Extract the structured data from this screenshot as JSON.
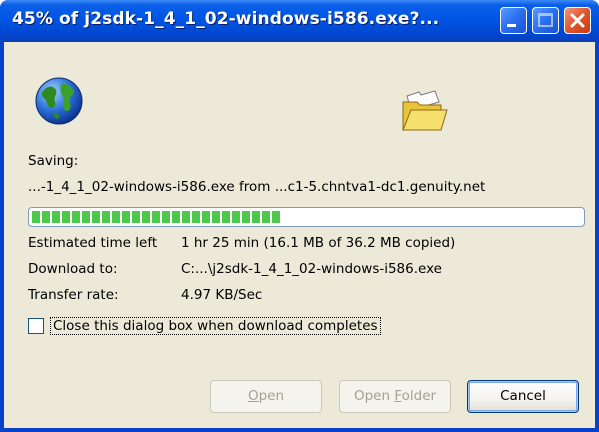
{
  "window": {
    "title": "45% of j2sdk-1_4_1_02-windows-i586.exe?..."
  },
  "icons": {
    "globe": "globe-icon",
    "folder": "open-folder-icon",
    "minimize": "minimize-icon",
    "maximize": "maximize-icon",
    "close": "close-icon"
  },
  "status": {
    "saving_label": "Saving:",
    "saving_value": "...-1_4_1_02-windows-i586.exe from ...c1-5.chntva1-dc1.genuity.net",
    "progress_percent": 45
  },
  "details": {
    "time_left_label": "Estimated time left",
    "time_left_value": "1 hr 25 min (16.1 MB of 36.2 MB copied)",
    "download_to_label": "Download to:",
    "download_to_value": "C:...\\j2sdk-1_4_1_02-windows-i586.exe",
    "transfer_rate_label": "Transfer rate:",
    "transfer_rate_value": "4.97 KB/Sec"
  },
  "options": {
    "close_when_done_label": "Close this dialog box when download completes",
    "close_when_done_checked": false
  },
  "buttons": {
    "open_first": "O",
    "open_rest": "pen",
    "open_folder_first": "Open ",
    "open_folder_ul": "F",
    "open_folder_rest": "older",
    "cancel": "Cancel"
  },
  "colors": {
    "titlebar": "#0055e5",
    "progress": "#4ec84a",
    "dialog_bg": "#ece9d8"
  }
}
